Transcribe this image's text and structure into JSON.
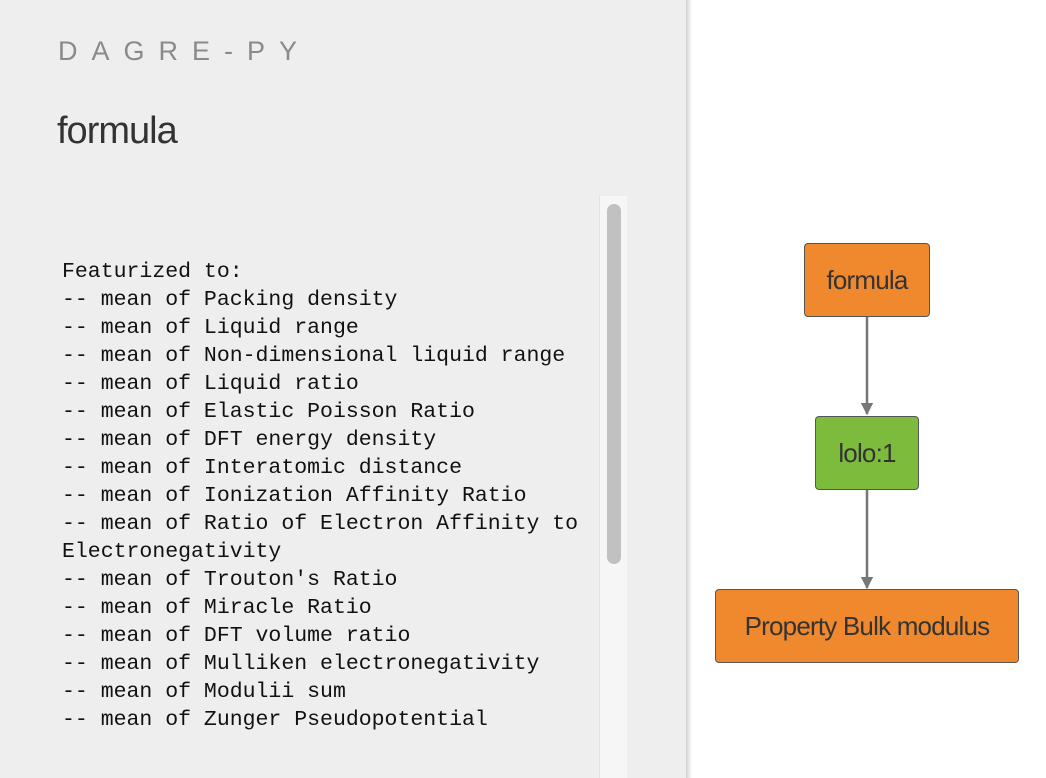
{
  "app": {
    "title": "DAGRE-PY"
  },
  "sidebar": {
    "selected_node_title": "formula",
    "details": "Featurized to:\n-- mean of Packing density\n-- mean of Liquid range\n-- mean of Non-dimensional liquid range\n-- mean of Liquid ratio\n-- mean of Elastic Poisson Ratio\n-- mean of DFT energy density\n-- mean of Interatomic distance\n-- mean of Ionization Affinity Ratio\n-- mean of Ratio of Electron Affinity to Electronegativity\n-- mean of Trouton's Ratio\n-- mean of Miracle Ratio\n-- mean of DFT volume ratio\n-- mean of Mulliken electronegativity\n-- mean of Modulii sum\n-- mean of Zunger Pseudopotential"
  },
  "graph": {
    "nodes": [
      {
        "id": "formula",
        "label": "formula",
        "color": "#f0892d"
      },
      {
        "id": "lolo",
        "label": "lolo:1",
        "color": "#7dbb3c"
      },
      {
        "id": "property",
        "label": "Property Bulk modulus",
        "color": "#f0892d"
      }
    ],
    "edges": [
      {
        "from": "formula",
        "to": "lolo"
      },
      {
        "from": "lolo",
        "to": "property"
      }
    ],
    "edge_color": "#777777"
  }
}
